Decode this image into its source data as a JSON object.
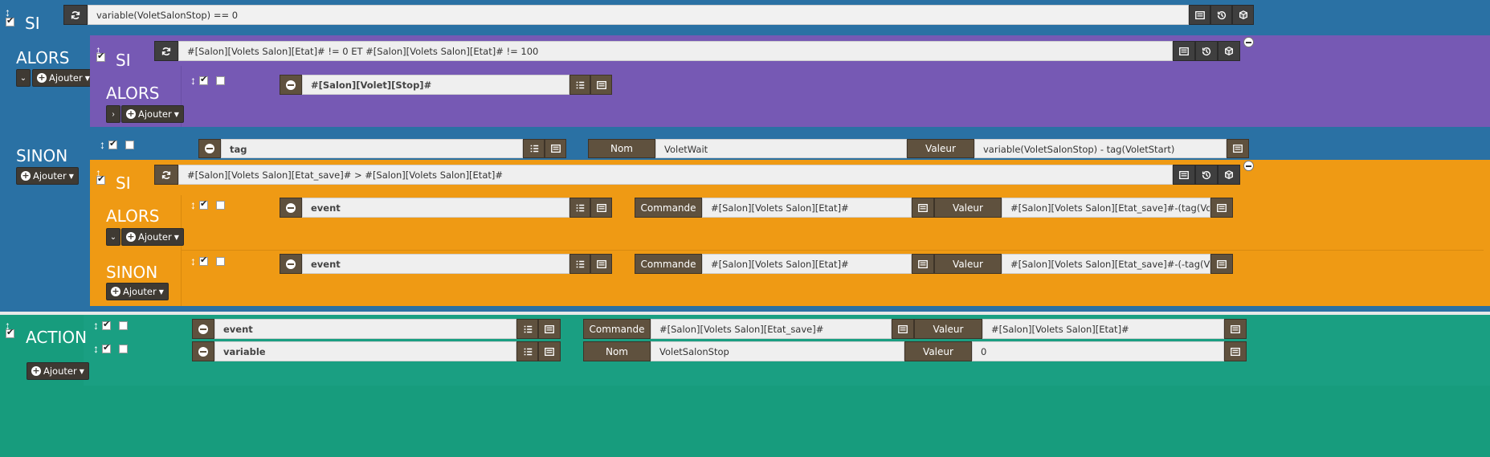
{
  "colors": {
    "si_block": "#2a71a4",
    "nested_si_block": "#7659b4",
    "nested_si2_block": "#ef9a14",
    "action_block": "#179c7d",
    "button_dark": "#5f513e"
  },
  "labels": {
    "si": "SI",
    "alors": "ALORS",
    "sinon": "SINON",
    "action": "ACTION",
    "ajouter": "Ajouter",
    "nom": "Nom",
    "valeur": "Valeur",
    "commande": "Commande"
  },
  "conditions": {
    "top": "variable(VoletSalonStop) == 0",
    "nested1": "#[Salon][Volets Salon][Etat]# != 0 ET #[Salon][Volets Salon][Etat]# != 100",
    "nested2": "#[Salon][Volets Salon][Etat_save]# > #[Salon][Volets Salon][Etat]#"
  },
  "nested1_alors": {
    "type": "#[Salon][Volet][Stop]#"
  },
  "sinon_tag": {
    "type": "tag",
    "nom": "VoletWait",
    "valeur": "variable(VoletSalonStop) - tag(VoletStart)"
  },
  "nested2_alors": {
    "type": "event",
    "commande": "#[Salon][Volets Salon][Etat]#",
    "valeur": "#[Salon][Volets Salon][Etat_save]#-(tag(VoletWait)*"
  },
  "nested2_sinon": {
    "type": "event",
    "commande": "#[Salon][Volets Salon][Etat]#",
    "valeur": "#[Salon][Volets Salon][Etat_save]#-(-tag(VoletWait)*"
  },
  "actions": [
    {
      "type": "event",
      "commande": "#[Salon][Volets Salon][Etat_save]#",
      "valeur": "#[Salon][Volets Salon][Etat]#"
    },
    {
      "type": "variable",
      "nom": "VoletSalonStop",
      "valeur": "0"
    }
  ]
}
